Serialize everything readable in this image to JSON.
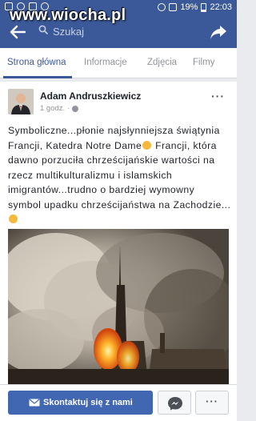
{
  "watermark": "www.wiocha.pl",
  "status_bar": {
    "battery": "19%",
    "time": "22:03"
  },
  "search": {
    "placeholder": "Szukaj"
  },
  "tabs": [
    {
      "label": "Strona główna",
      "active": true
    },
    {
      "label": "Informacje",
      "active": false
    },
    {
      "label": "Zdjęcia",
      "active": false
    },
    {
      "label": "Filmy",
      "active": false
    }
  ],
  "post": {
    "author": "Adam Andruszkiewicz",
    "time": "1 godz.",
    "lines": [
      "Symboliczne...płonie najsłynniejsza świątynia",
      "Francji, Katedra Notre Dame",
      " Francji, która",
      "dawno porzuciła chrześcijańskie wartości na",
      "rzecz multikulturalizmu i islamskich",
      "imigrantów...trudno o bardziej wymowny",
      "symbol upadku chrześcijaństwa na Zachodzie..."
    ]
  },
  "actions": {
    "contact_label": "Skontaktuj się z nami",
    "more_label": "···"
  },
  "colors": {
    "brand": "#3b5998",
    "button": "#4267b2",
    "fire": "#ff8a1e"
  }
}
